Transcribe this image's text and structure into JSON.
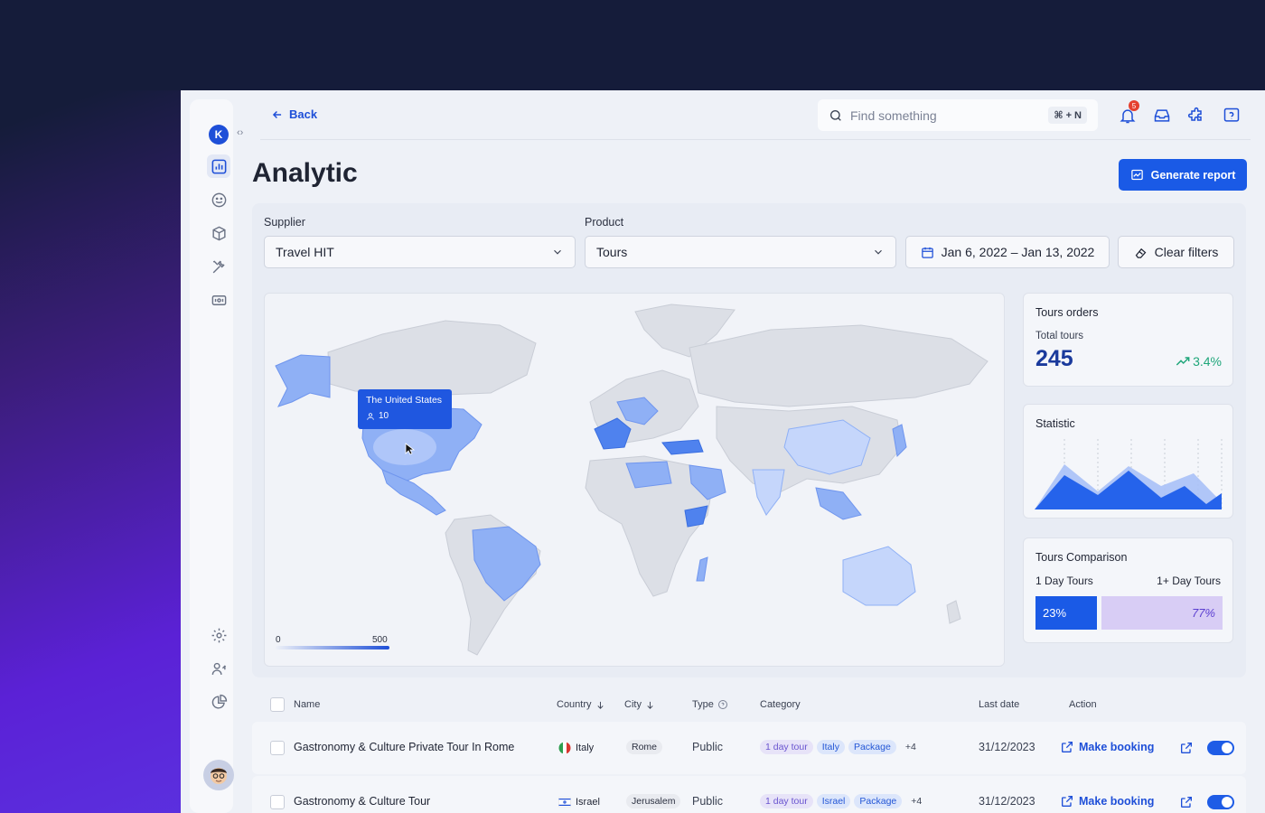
{
  "header": {
    "back_label": "Back",
    "search_placeholder": "Find something",
    "search_shortcut": "⌘ + N",
    "notification_count": "5",
    "page_title": "Analytic",
    "generate_report_label": "Generate report"
  },
  "filters": {
    "supplier_label": "Supplier",
    "supplier_value": "Travel HIT",
    "product_label": "Product",
    "product_value": "Tours",
    "date_range": "Jan 6, 2022 – Jan 13, 2022",
    "clear_label": "Clear filters"
  },
  "map": {
    "tooltip_country": "The United States",
    "tooltip_value": "10",
    "scale_min": "0",
    "scale_max": "500"
  },
  "tours_orders": {
    "title": "Tours orders",
    "subtitle": "Total tours",
    "total": "245",
    "change": "3.4%"
  },
  "statistic": {
    "title": "Statistic"
  },
  "comparison": {
    "title": "Tours Comparison",
    "left_label": "1 Day Tours",
    "right_label": "1+ Day Tours",
    "left_percent": "23%",
    "right_percent": "77%",
    "left_fraction": 0.23
  },
  "table": {
    "columns": [
      "Name",
      "Country",
      "City",
      "Type",
      "Category",
      "Last date",
      "Action"
    ],
    "rows": [
      {
        "name": "Gastronomy & Culture Private Tour In Rome",
        "country": "Italy",
        "city": "Rome",
        "type": "Public",
        "categories": [
          "1 day tour",
          "Italy",
          "Package"
        ],
        "more": "+4",
        "last_date": "31/12/2023",
        "action": "Make booking"
      },
      {
        "name": "Gastronomy & Culture Tour",
        "country": "Israel",
        "city": "Jerusalem",
        "type": "Public",
        "categories": [
          "1 day tour",
          "Israel",
          "Package"
        ],
        "more": "+4",
        "last_date": "31/12/2023",
        "action": "Make booking"
      }
    ]
  },
  "colors": {
    "accent": "#1a5ae6",
    "positive": "#1fa67a",
    "comparison_right": "#d8cdf5"
  }
}
